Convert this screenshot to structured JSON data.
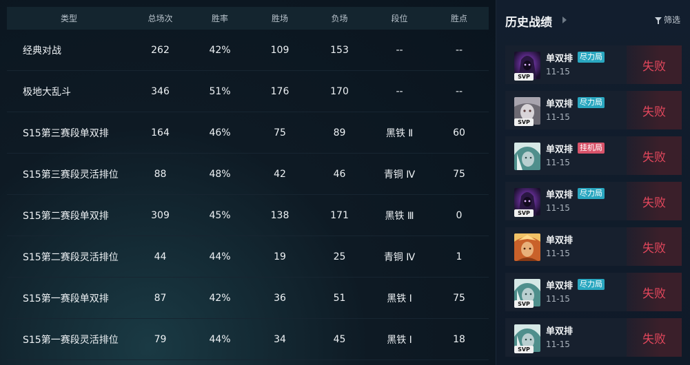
{
  "table": {
    "headers": [
      "类型",
      "总场次",
      "胜率",
      "胜场",
      "负场",
      "段位",
      "胜点"
    ],
    "rows": [
      [
        "经典对战",
        "262",
        "42%",
        "109",
        "153",
        "--",
        "--"
      ],
      [
        "极地大乱斗",
        "346",
        "51%",
        "176",
        "170",
        "--",
        "--"
      ],
      [
        "S15第三赛段单双排",
        "164",
        "46%",
        "75",
        "89",
        "黑铁 Ⅱ",
        "60"
      ],
      [
        "S15第三赛段灵活排位",
        "88",
        "48%",
        "42",
        "46",
        "青铜 Ⅳ",
        "75"
      ],
      [
        "S15第二赛段单双排",
        "309",
        "45%",
        "138",
        "171",
        "黑铁 Ⅲ",
        "0"
      ],
      [
        "S15第二赛段灵活排位",
        "44",
        "44%",
        "19",
        "25",
        "青铜 Ⅳ",
        "1"
      ],
      [
        "S15第一赛段单双排",
        "87",
        "42%",
        "36",
        "51",
        "黑铁 Ⅰ",
        "75"
      ],
      [
        "S15第一赛段灵活排位",
        "79",
        "44%",
        "34",
        "45",
        "黑铁 Ⅰ",
        "18"
      ]
    ]
  },
  "history": {
    "title": "历史战绩",
    "filter_label": "筛选",
    "matches": [
      {
        "mode": "单双排",
        "tag": "尽力局",
        "tag_type": "try",
        "date": "11-15",
        "result": "失败",
        "svp": "SVP",
        "champion_icon": "hooded-purple-champion-icon"
      },
      {
        "mode": "单双排",
        "tag": "尽力局",
        "tag_type": "try",
        "date": "11-15",
        "result": "失败",
        "svp": "SVP",
        "champion_icon": "pale-mage-champion-icon"
      },
      {
        "mode": "单双排",
        "tag": "挂机局",
        "tag_type": "afk",
        "date": "11-15",
        "result": "失败",
        "svp": "",
        "champion_icon": "white-hair-champion-icon"
      },
      {
        "mode": "单双排",
        "tag": "尽力局",
        "tag_type": "try",
        "date": "11-15",
        "result": "失败",
        "svp": "SVP",
        "champion_icon": "hooded-purple-champion-icon"
      },
      {
        "mode": "单双排",
        "tag": "",
        "tag_type": "",
        "date": "11-15",
        "result": "失败",
        "svp": "",
        "champion_icon": "golden-warrior-champion-icon"
      },
      {
        "mode": "单双排",
        "tag": "尽力局",
        "tag_type": "try",
        "date": "11-15",
        "result": "失败",
        "svp": "SVP",
        "champion_icon": "white-hair-champion-icon"
      },
      {
        "mode": "单双排",
        "tag": "",
        "tag_type": "",
        "date": "11-15",
        "result": "失败",
        "svp": "SVP",
        "champion_icon": "white-hair-champion-icon"
      }
    ]
  },
  "colors": {
    "loss_text": "#e2475c",
    "tag_try": "#2aa7c0",
    "tag_afk": "#d9536a"
  }
}
